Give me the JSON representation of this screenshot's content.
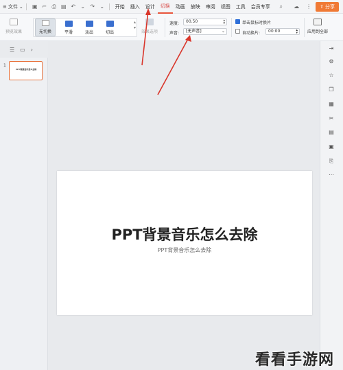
{
  "menubar": {
    "file_label": "文件",
    "tabs": [
      {
        "label": "开始"
      },
      {
        "label": "插入"
      },
      {
        "label": "设计"
      },
      {
        "label": "切换",
        "active": true
      },
      {
        "label": "动画"
      },
      {
        "label": "放映"
      },
      {
        "label": "审阅"
      },
      {
        "label": "视图"
      },
      {
        "label": "工具"
      },
      {
        "label": "会员专享"
      }
    ],
    "share_label": "分享",
    "accent_color": "#e8533a"
  },
  "ribbon": {
    "preview_label": "预览效果",
    "effects": [
      {
        "label": "无切换",
        "selected": true
      },
      {
        "label": "平滑"
      },
      {
        "label": "淡出"
      },
      {
        "label": "切出"
      }
    ],
    "effect_options_label": "效果选项",
    "speed_label": "速度:",
    "speed_value": "00.50",
    "sound_label": "声音:",
    "sound_value": "[无声音]",
    "click_advance_label": "单击鼠标时换片",
    "auto_advance_label": "自动换片:",
    "auto_advance_value": "00:00",
    "apply_all_label": "应用到全部"
  },
  "slides_panel": {
    "slide_number": "1",
    "thumb_title": "PPT背景音乐怎么去除"
  },
  "slide": {
    "title": "PPT背景音乐怎么去除",
    "subtitle": "PPT背景音乐怎么去除"
  },
  "watermark": "看看手游网"
}
